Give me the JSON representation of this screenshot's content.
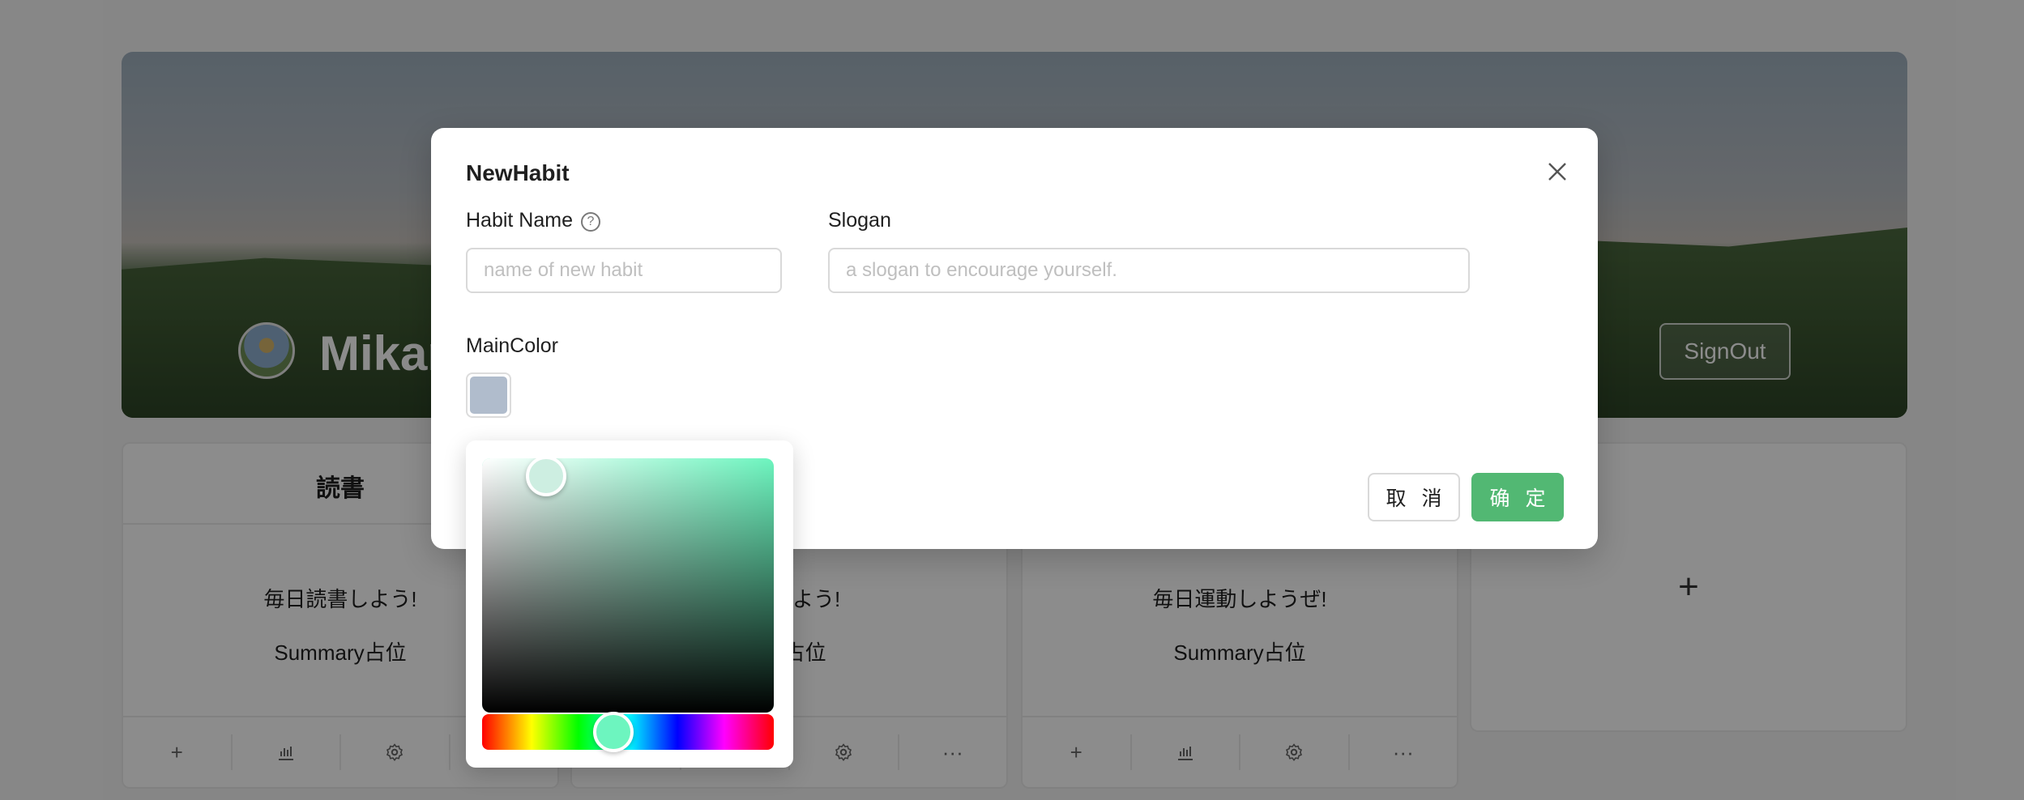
{
  "page": {
    "username": "Mikan",
    "signout_label": "SignOut"
  },
  "cards": [
    {
      "title": "読書",
      "slogan": "毎日読書しよう!",
      "summary": "Summary占位"
    },
    {
      "title": "",
      "slogan": "てみよう!",
      "summary": "ry占位"
    },
    {
      "title": "",
      "slogan": "毎日運動しようぜ!",
      "summary": "Summary占位"
    }
  ],
  "add_card": {
    "label": "+"
  },
  "card_actions": {
    "add": "+",
    "stats_icon": "bar-chart-icon",
    "settings_icon": "gear-icon",
    "more": "···"
  },
  "modal": {
    "title": "NewHabit",
    "habit_name_label": "Habit Name",
    "habit_name_placeholder": "name of new habit",
    "habit_name_value": "",
    "slogan_label": "Slogan",
    "slogan_placeholder": "a slogan to encourage yourself.",
    "slogan_value": "",
    "main_color_label": "MainColor",
    "cancel_label": "取 消",
    "ok_label": "确 定"
  },
  "colors": {
    "selected_swatch": "#b0bccc",
    "picker_hue": "#6df5bf",
    "ok_button": "#52b873",
    "close_icon": "#555555"
  },
  "color_picker": {
    "saturation": 0.22,
    "value": 0.93,
    "hue_fraction": 0.45
  }
}
